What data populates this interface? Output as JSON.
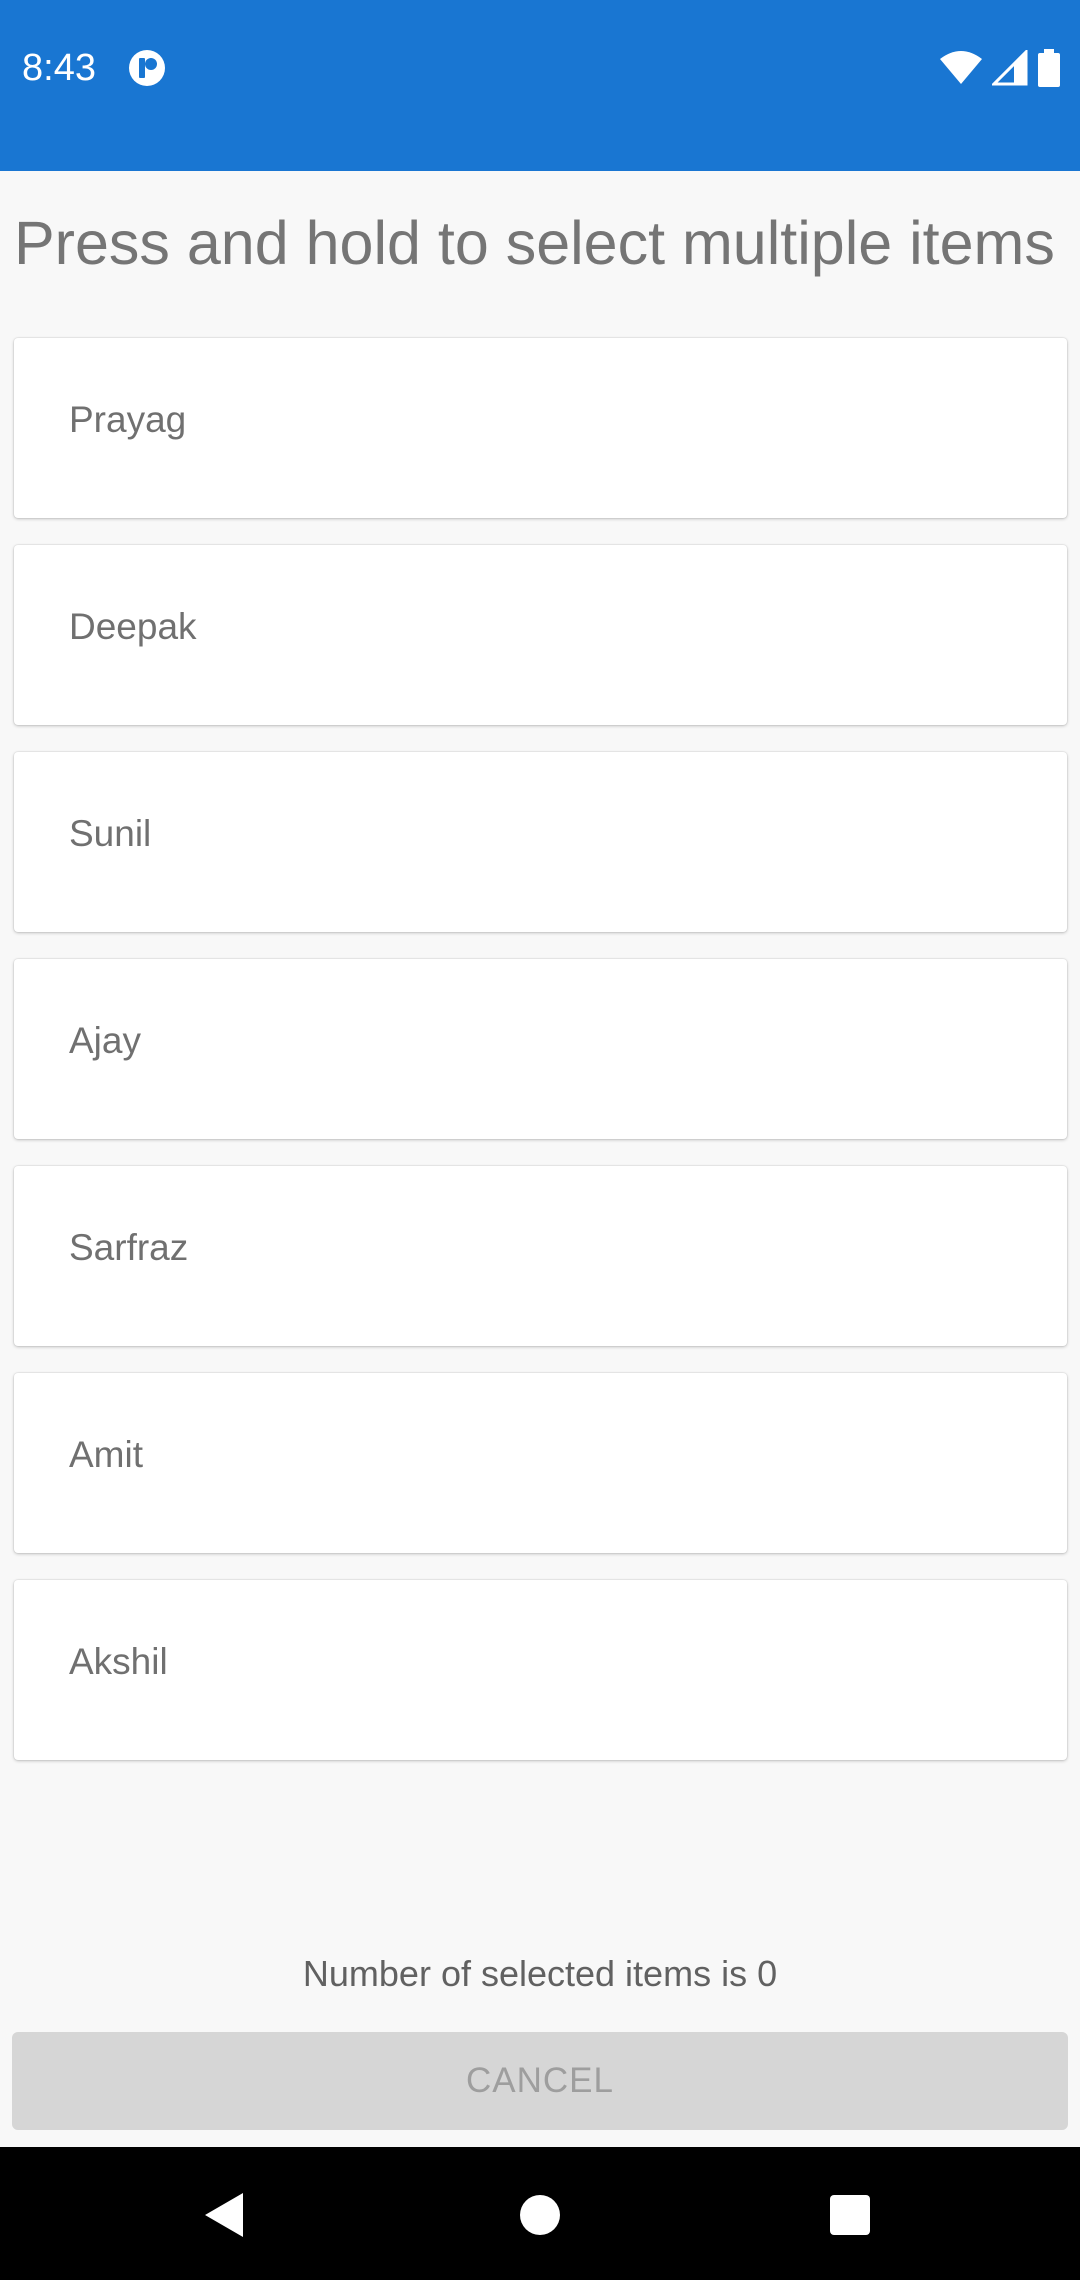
{
  "status_bar": {
    "time": "8:43",
    "icons": [
      "app-notification-icon",
      "wifi-icon",
      "cellular-signal-icon",
      "battery-icon"
    ]
  },
  "header": {
    "title": "Press and hold to select multiple items"
  },
  "list": {
    "items": [
      {
        "label": "Prayag"
      },
      {
        "label": "Deepak"
      },
      {
        "label": "Sunil"
      },
      {
        "label": "Ajay"
      },
      {
        "label": "Sarfraz"
      },
      {
        "label": "Amit"
      },
      {
        "label": "Akshil"
      }
    ]
  },
  "footer": {
    "selected_count_text": "Number of selected items is 0",
    "cancel_label": "CANCEL"
  },
  "nav": {
    "icons": [
      "back-icon",
      "home-icon",
      "recents-icon"
    ]
  },
  "colors": {
    "accent": "#1976d2",
    "background": "#f8f8f8",
    "button_disabled": "#d6d6d6"
  }
}
